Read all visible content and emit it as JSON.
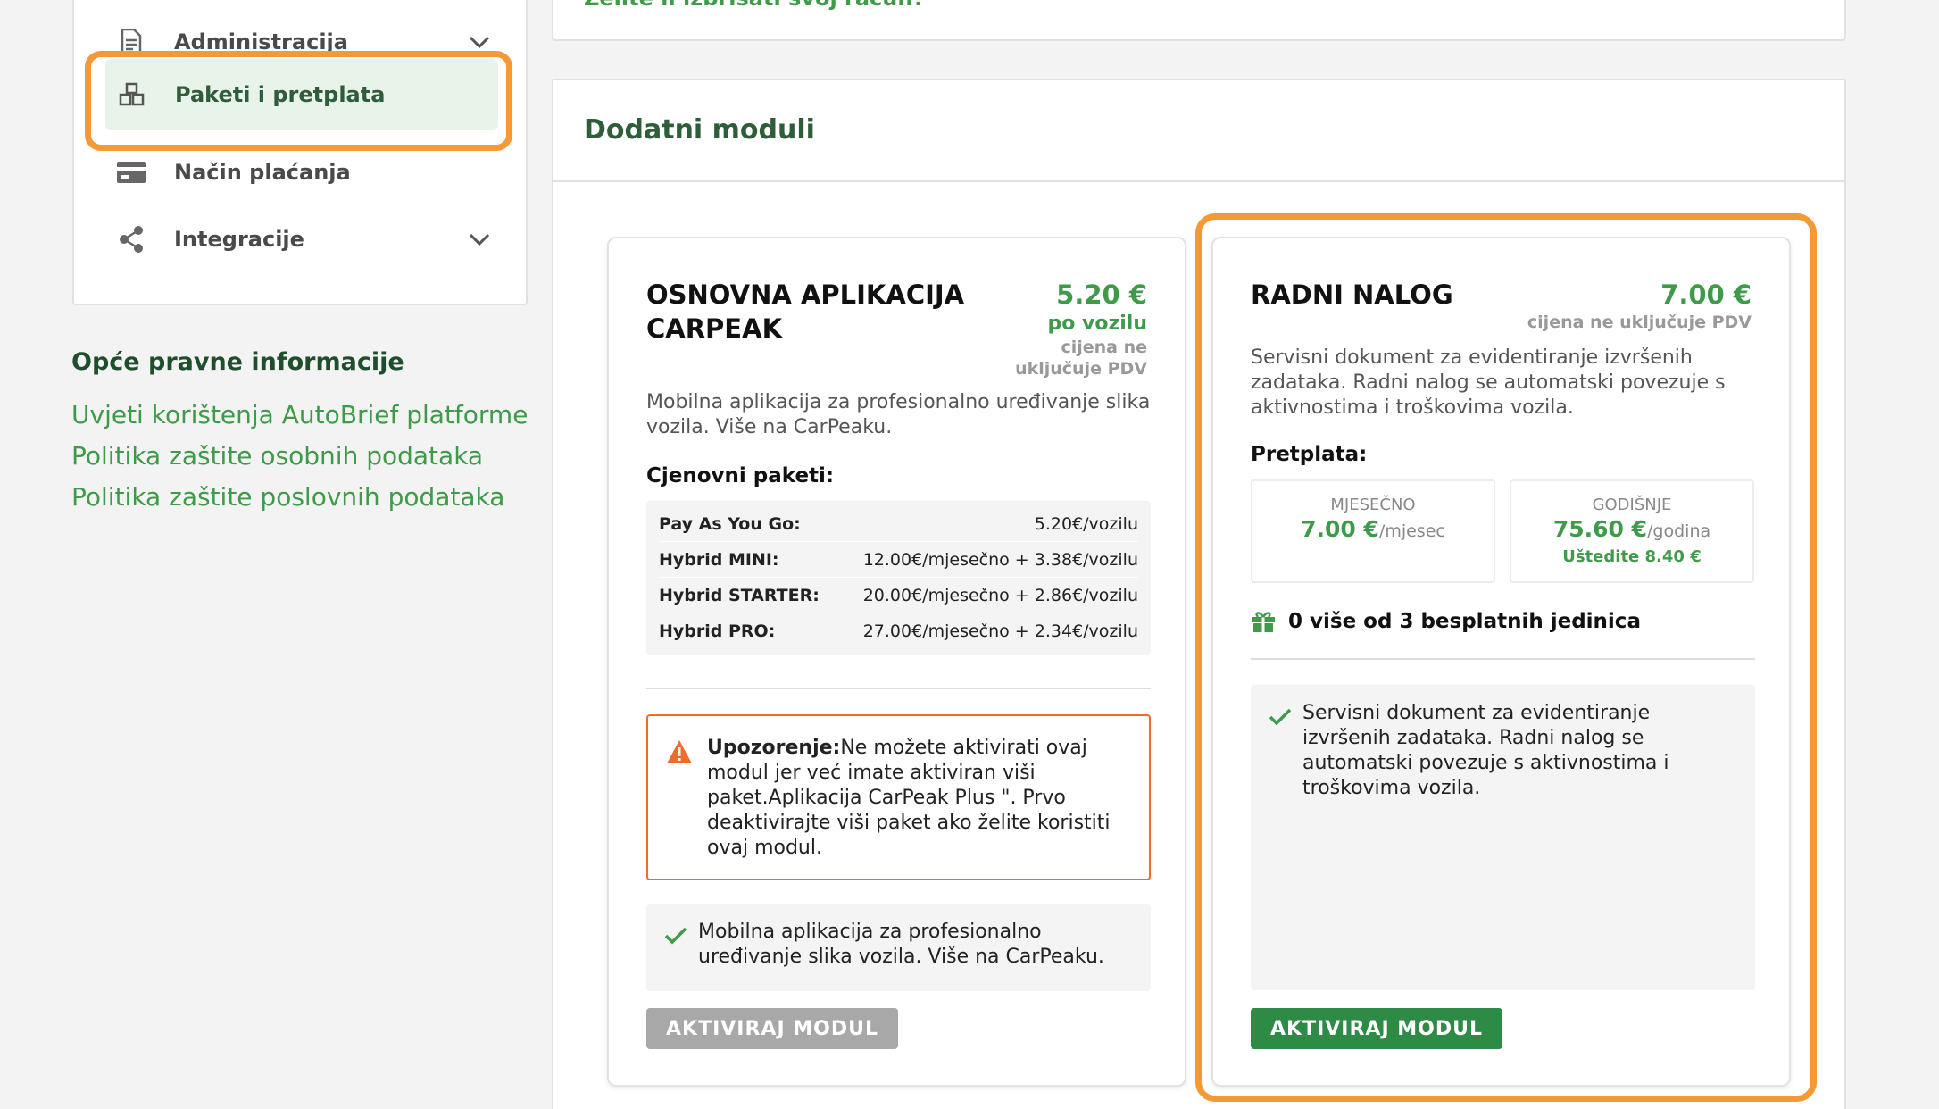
{
  "sidebar": {
    "items": [
      {
        "label": "Administracija",
        "icon": "document-icon"
      },
      {
        "label": "Paketi i pretplata",
        "icon": "boxes-icon",
        "active": true
      },
      {
        "label": "Način plaćanja",
        "icon": "credit-card-icon"
      },
      {
        "label": "Integracije",
        "icon": "share-icon"
      }
    ]
  },
  "legal": {
    "title": "Opće pravne informacije",
    "links": [
      "Uvjeti korištenja AutoBrief platforme",
      "Politika zaštite osobnih podataka",
      "Politika zaštite poslovnih podataka"
    ]
  },
  "top_panel": {
    "cut_text": "Želite li izbrisati svoj račun?"
  },
  "modules": {
    "title": "Dodatni moduli",
    "carpeak": {
      "title": "OSNOVNA APLIKACIJA CARPEAK",
      "price": "5.20 €",
      "price_unit": "po vozilu",
      "vat_note": "cijena ne uključuje PDV",
      "description": "Mobilna aplikacija za profesionalno uređivanje slika vozila. Više na CarPeaku.",
      "packages_label": "Cjenovni paketi:",
      "packages": [
        {
          "name": "Pay As You Go:",
          "price": "5.20€/vozilu"
        },
        {
          "name": "Hybrid MINI:",
          "price": "12.00€/mjesečno + 3.38€/vozilu"
        },
        {
          "name": "Hybrid STARTER:",
          "price": "20.00€/mjesečno + 2.86€/vozilu"
        },
        {
          "name": "Hybrid PRO:",
          "price": "27.00€/mjesečno + 2.34€/vozilu"
        }
      ],
      "warning_label": "Upozorenje:",
      "warning_text": "Ne možete aktivirati ovaj modul jer već imate aktiviran viši paket.Aplikacija CarPeak Plus \". Prvo deaktivirajte viši paket ako želite koristiti ovaj modul.",
      "feature": "Mobilna aplikacija za profesionalno uređivanje slika vozila. Više na CarPeaku.",
      "button": "AKTIVIRAJ MODUL",
      "button_enabled": false
    },
    "radni_nalog": {
      "title": "RADNI NALOG",
      "price": "7.00 €",
      "vat_note": "cijena ne uključuje PDV",
      "description": "Servisni dokument za evidentiranje izvršenih zadataka. Radni nalog se automatski povezuje s aktivnostima i troškovima vozila.",
      "subscription_label": "Pretplata:",
      "monthly": {
        "label": "MJESEČNO",
        "price": "7.00 €",
        "unit": "/mjesec"
      },
      "yearly": {
        "label": "GODIŠNJE",
        "price": "75.60 €",
        "unit": "/godina",
        "savings": "Uštedite 8.40 €"
      },
      "free_units": "0 više od 3 besplatnih jedinica",
      "feature": "Servisni dokument za evidentiranje izvršenih zadataka. Radni nalog se automatski povezuje s aktivnostima i troškovima vozila.",
      "button": "AKTIVIRAJ MODUL",
      "button_enabled": true
    }
  },
  "colors": {
    "accent_green": "#3f9a4a",
    "button_green": "#2e8b46",
    "highlight_orange": "#f39a36",
    "warning_orange": "#f06b2c"
  }
}
